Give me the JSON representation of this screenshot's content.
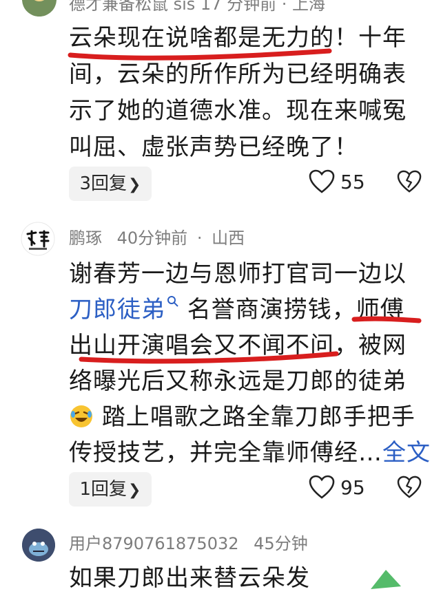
{
  "comments": [
    {
      "meta_top": "德才兼备松鼠 sis  17 分钟前 · 上海",
      "lines": [
        "云朵现在说啥都是无力的！十年",
        "间，云朵的所作所为已经明确表",
        "示了她的道德水准。现在来喊冤",
        "叫屈、虚张声势已经晚了！"
      ],
      "reply_label": "3回复",
      "like_count": "55"
    },
    {
      "author": "鹏琢",
      "time": "40分钟前",
      "location": "山西",
      "line1": "谢春芳一边与恩师打官司一边以",
      "line2_link": "刀郎徒弟",
      "line2_rest": " 名誉商演捞钱，师傅",
      "line3": "出山开演唱会又不闻不问，被网",
      "line4": "络曝光后又称永远是刀郎的徒弟",
      "line5": "踏上唱歌之路全靠刀郎手把手",
      "line6": "传授技艺，并完全靠师傅经…",
      "more_label": "全文",
      "reply_label": "1回复",
      "like_count": "95"
    },
    {
      "author": "用户8790761875032",
      "time": "45分钟",
      "line1": "如果刀郎出来替云朵发"
    }
  ],
  "colors": {
    "underline_red": "#d81e1e",
    "link_blue": "#2c5fc4",
    "meta_gray": "#7d7d7d"
  },
  "icons": [
    "heart-outline-icon",
    "broken-heart-icon",
    "search-small-icon",
    "laughing-crying-emoji",
    "chevron-right-icon"
  ]
}
